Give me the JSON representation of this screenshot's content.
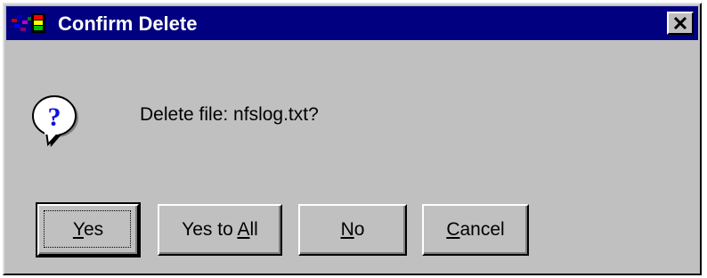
{
  "window": {
    "title": "Confirm Delete",
    "close_glyph": "✕"
  },
  "icons": {
    "app": "app-icon",
    "close": "close-icon",
    "message": "question-icon"
  },
  "message": {
    "text": "Delete file: nfslog.txt?"
  },
  "buttons": [
    {
      "id": "yes",
      "label_pre": "",
      "mnemonic": "Y",
      "label_post": "es",
      "default": true
    },
    {
      "id": "yes-to-all",
      "label_pre": "Yes to ",
      "mnemonic": "A",
      "label_post": "ll",
      "default": false
    },
    {
      "id": "no",
      "label_pre": "",
      "mnemonic": "N",
      "label_post": "o",
      "default": false
    },
    {
      "id": "cancel",
      "label_pre": "",
      "mnemonic": "C",
      "label_post": "ancel",
      "default": false
    }
  ],
  "colors": {
    "titlebar": "#000080",
    "face": "#c0c0c0",
    "title_text": "#ffffff",
    "question_mark": "#1010e0"
  }
}
